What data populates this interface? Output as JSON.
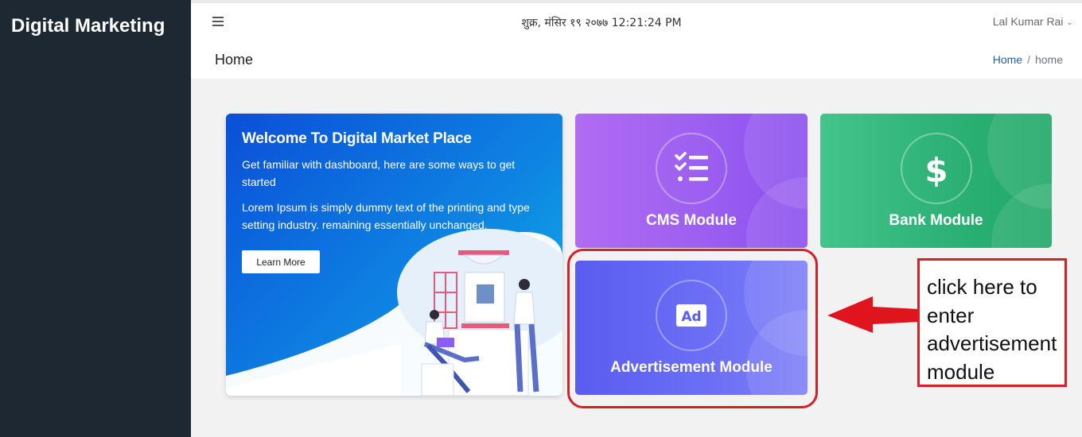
{
  "sidebar": {
    "brand": "Digital Marketing"
  },
  "header": {
    "datetime": "शुक्र, मंसिर १९ २०७७ 12:21:24 PM",
    "user_name": "Lal Kumar Rai",
    "user_chevron": "⌄"
  },
  "pagehead": {
    "title": "Home",
    "breadcrumb": {
      "link": "Home",
      "separator": "/",
      "current": "home"
    }
  },
  "welcome": {
    "title": "Welcome To Digital Market Place",
    "text1": "Get familiar with dashboard, here are some ways to get started",
    "text2": "Lorem Ipsum is simply dummy text of the printing and type setting industry. remaining essentially unchanged.",
    "button_label": "Learn More"
  },
  "modules": {
    "cms": {
      "label": "CMS Module",
      "icon": "checklist-icon"
    },
    "bank": {
      "label": "Bank Module",
      "icon": "dollar-icon"
    },
    "advertisement": {
      "label": "Advertisement Module",
      "icon": "ad-icon",
      "icon_text": "Ad"
    }
  },
  "annotation": {
    "callout_text": "click here to enter advertisement module",
    "color": "#d61f26"
  },
  "colors": {
    "sidebar_bg": "#1e2833",
    "cms_accent": "#9c5ff0",
    "bank_accent": "#2db176",
    "adv_accent": "#6b6ef5",
    "welcome_accent": "#0e86e3",
    "link": "#1f5fa8"
  }
}
